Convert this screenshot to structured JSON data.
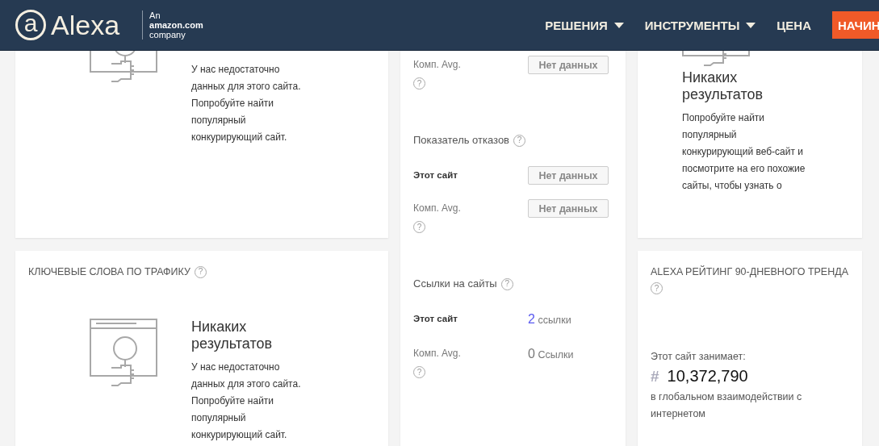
{
  "header": {
    "logo": {
      "mark": "a",
      "name": "Alexa",
      "tagline": [
        "An",
        "amazon.com",
        "company"
      ]
    },
    "nav": [
      {
        "label": "РЕШЕНИЯ",
        "dropdown": true
      },
      {
        "label": "ИНСТРУМЕНТЫ",
        "dropdown": true
      },
      {
        "label": "ЦЕНА",
        "dropdown": false
      }
    ],
    "cta": "НАЧИН"
  },
  "top_left_card": {
    "text": [
      "У нас недостаточно",
      "данных для этого сайта.",
      "Попробуйте найти",
      "популярный",
      "конкурирующий сайт."
    ]
  },
  "keywords_card": {
    "title": "КЛЮЧЕВЫЕ СЛОВА ПО ТРАФИКУ",
    "help": "?",
    "heading": "Никаких результатов",
    "text": [
      "У нас недостаточно",
      "данных для этого сайта.",
      "Попробуйте найти",
      "популярный",
      "конкурирующий сайт."
    ]
  },
  "metrics": [
    {
      "rows": [
        {
          "kind": "comp",
          "label": "Комп. Avg.",
          "help": "?",
          "value": "Нет данных"
        }
      ]
    },
    {
      "title": "Показатель отказов",
      "help": "?",
      "rows": [
        {
          "kind": "site",
          "label": "Этот сайт",
          "value": "Нет данных"
        },
        {
          "kind": "comp",
          "label": "Комп. Avg.",
          "help": "?",
          "value": "Нет данных"
        }
      ]
    },
    {
      "title": "Ссылки на сайты",
      "help": "?",
      "rows": [
        {
          "kind": "site",
          "label": "Этот сайт",
          "count": "2",
          "unit": "ссылки"
        },
        {
          "kind": "comp",
          "label": "Комп. Avg.",
          "help": "?",
          "count": "0",
          "unit": "Ссылки"
        }
      ]
    }
  ],
  "top_right_card": {
    "heading": "Никаких результатов",
    "text": [
      "Попробуйте найти",
      "популярный",
      "конкурирующий веб-сайт и",
      "посмотрите на его похожие",
      "сайты, чтобы узнать о"
    ]
  },
  "rank_card": {
    "title": "ALEXA РЕЙТИНГ 90-ДНЕВНОГО ТРЕНДА",
    "help": "?",
    "caption": "Этот сайт занимает:",
    "hash": "#",
    "rank": "10,372,790",
    "note": [
      "в глобальном взаимодействии с",
      "интернетом"
    ]
  }
}
